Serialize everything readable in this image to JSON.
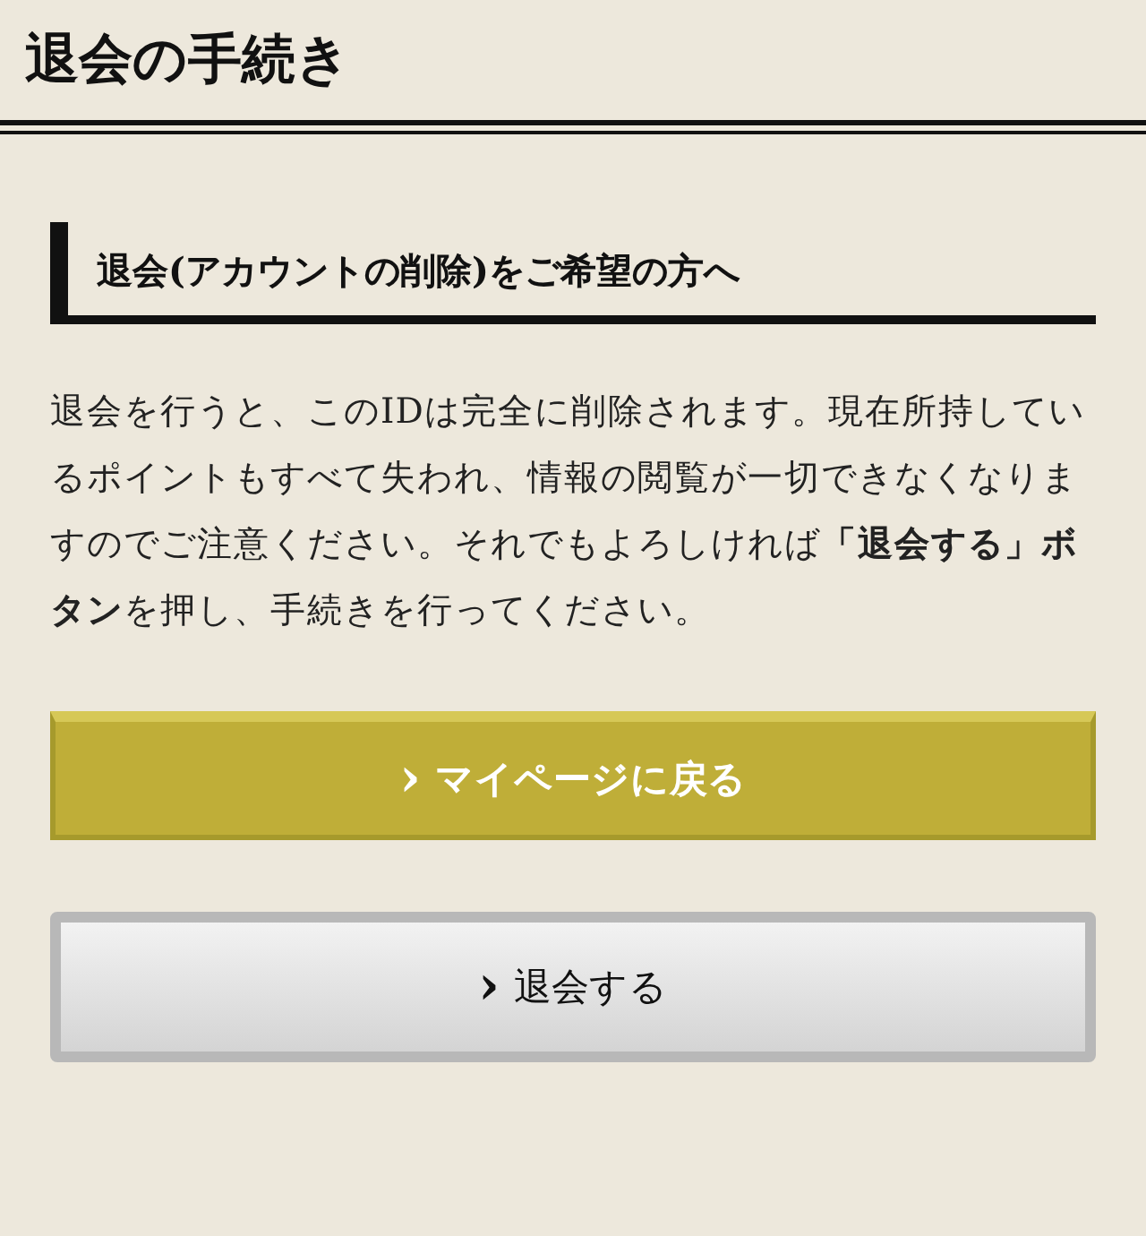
{
  "page_title": "退会の手続き",
  "section_heading": "退会(アカウントの削除)をご希望の方へ",
  "notice": "退会を行うと、このIDは完全に削除されます。現在所持しているポイントもすべて失われ、情報の閲覧が一切できなくなりますのでご注意ください。それでもよろしければ**「退会する」ボタン**を押し、手続きを行ってください。",
  "buttons": [
    {
      "kind": "primary",
      "icon": "›",
      "label": "マイページに戻る"
    },
    {
      "kind": "secondary",
      "icon": "›",
      "label": "退会する"
    }
  ]
}
